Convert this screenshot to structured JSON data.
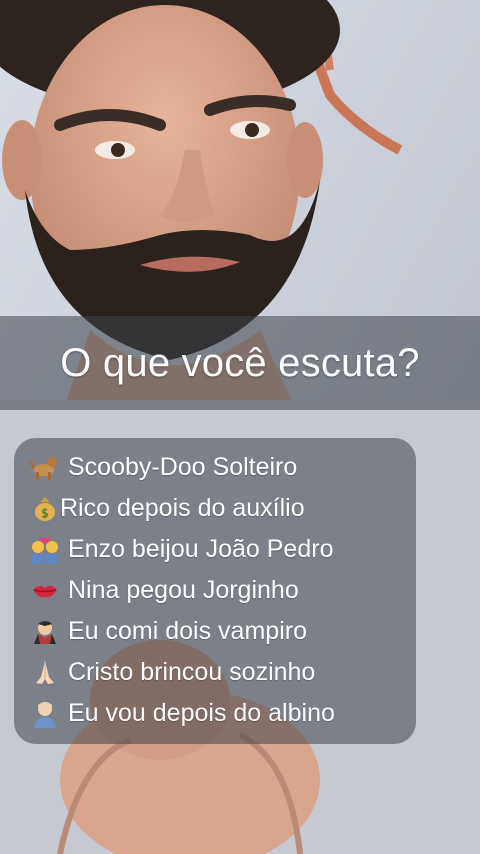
{
  "title": "O que você escuta?",
  "items": [
    {
      "icon": "dog-icon",
      "label": "Scooby-Doo Solteiro"
    },
    {
      "icon": "money-bag-icon",
      "label": "Rico depois do auxílio"
    },
    {
      "icon": "couple-with-heart-icon",
      "label": "Enzo beijou João Pedro"
    },
    {
      "icon": "kiss-lips-icon",
      "label": "Nina pegou Jorginho"
    },
    {
      "icon": "vampire-icon",
      "label": "Eu comi dois vampiro"
    },
    {
      "icon": "praying-hands-icon",
      "label": "Cristo brincou sozinho"
    },
    {
      "icon": "person-icon",
      "label": "Eu vou depois do albino"
    }
  ],
  "colors": {
    "background": "#c9cdd6",
    "overlay": "#3c424a",
    "text": "#ffffff"
  }
}
